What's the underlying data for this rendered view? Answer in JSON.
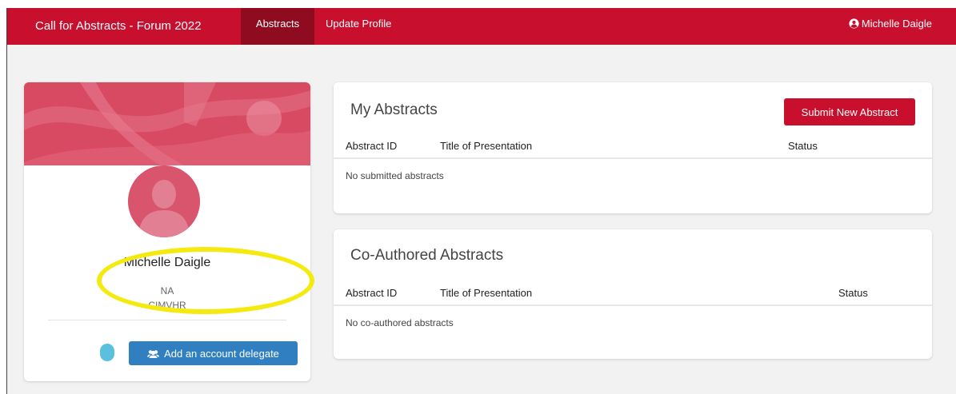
{
  "navbar": {
    "brand": "Call for Abstracts - Forum 2022",
    "items": [
      {
        "label": "Abstracts",
        "active": true
      },
      {
        "label": "Update Profile",
        "active": false
      }
    ],
    "user": "Michelle Daigle",
    "user_icon": "user-circle-icon",
    "color": "#c8102e"
  },
  "profile": {
    "name": "Michelle Daigle",
    "line1": "NA",
    "line2": "CIMVHR",
    "delegate_button": "Add an account delegate",
    "delegate_icon": "users-icon"
  },
  "my_abstracts": {
    "title": "My Abstracts",
    "submit_button": "Submit New Abstract",
    "columns": [
      "Abstract ID",
      "Title of Presentation",
      "Status"
    ],
    "empty": "No submitted abstracts"
  },
  "co_authored": {
    "title": "Co-Authored Abstracts",
    "columns": [
      "Abstract ID",
      "Title of Presentation",
      "Status"
    ],
    "empty": "No co-authored abstracts"
  }
}
